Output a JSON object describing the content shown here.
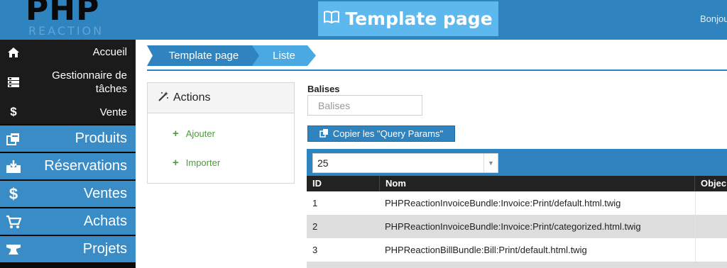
{
  "header": {
    "logo_text": "PHP",
    "logo_subtext": "REACTION",
    "page_title": "Template page",
    "greeting": "Bonjour"
  },
  "sidebar": {
    "items": [
      {
        "label": "Accueil",
        "icon": "home-icon"
      },
      {
        "label": "Gestionnaire de tâches",
        "icon": "tasks-icon"
      },
      {
        "label": "Vente",
        "icon": "dollar-icon"
      },
      {
        "label": "Produits",
        "icon": "products-icon"
      },
      {
        "label": "Réservations",
        "icon": "inbox-icon"
      },
      {
        "label": "Ventes",
        "icon": "dollar-icon"
      },
      {
        "label": "Achats",
        "icon": "cart-icon"
      },
      {
        "label": "Projets",
        "icon": "anvil-icon"
      }
    ]
  },
  "breadcrumb": [
    "Template page",
    "Liste"
  ],
  "actions": {
    "title": "Actions",
    "items": [
      "Ajouter",
      "Importer"
    ]
  },
  "filters": {
    "balises_label": "Balises",
    "balises_placeholder": "Balises",
    "copy_button": "Copier les \"Query Params\""
  },
  "table": {
    "page_size": "25",
    "columns": [
      "ID",
      "Nom",
      "Objec"
    ],
    "rows": [
      {
        "id": "1",
        "nom": "PHPReactionInvoiceBundle:Invoice:Print/default.html.twig"
      },
      {
        "id": "2",
        "nom": "PHPReactionInvoiceBundle:Invoice:Print/categorized.html.twig"
      },
      {
        "id": "3",
        "nom": "PHPReactionBillBundle:Bill:Print/default.html.twig"
      }
    ]
  }
}
